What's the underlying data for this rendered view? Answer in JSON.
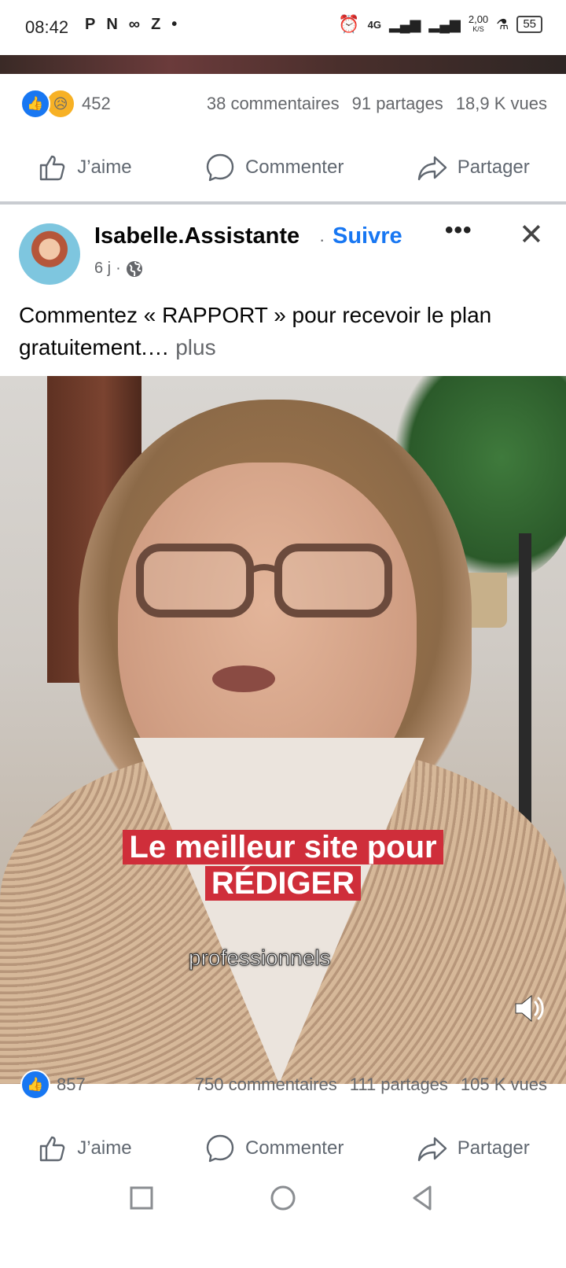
{
  "status_bar": {
    "time": "08:42",
    "left_icons": [
      "P",
      "N",
      "∞",
      "Z",
      "•"
    ],
    "network": "4G",
    "speed": "2,00",
    "speed_unit": "K/S",
    "battery": "55"
  },
  "prev_post": {
    "stats": {
      "reactions_count": "452",
      "comments": "38 commentaires",
      "shares": "91 partages",
      "views": "18,9 K vues"
    },
    "actions": {
      "like": "J’aime",
      "comment": "Commenter",
      "share": "Partager"
    }
  },
  "post": {
    "author": "Isabelle.Assistante",
    "separator": "·",
    "follow": "Suivre",
    "more": "•••",
    "close": "✕",
    "age": "6 j",
    "meta_dot": "·",
    "caption": "Commentez « RAPPORT » pour recevoir le plan gratuitement.…",
    "caption_more": " plus",
    "video": {
      "title_line1": "Le meilleur site pour",
      "title_line2": "RÉDIGER",
      "subtitle": "professionnels"
    },
    "stats": {
      "reactions_count": "857",
      "comments": "750 commentaires",
      "shares": "111 partages",
      "views": "105 K vues"
    },
    "actions": {
      "like": "J’aime",
      "comment": "Commenter",
      "share": "Partager"
    }
  },
  "colors": {
    "accent": "#1877f2",
    "overlay_red": "#cf2e3a",
    "muted": "#65676b"
  }
}
